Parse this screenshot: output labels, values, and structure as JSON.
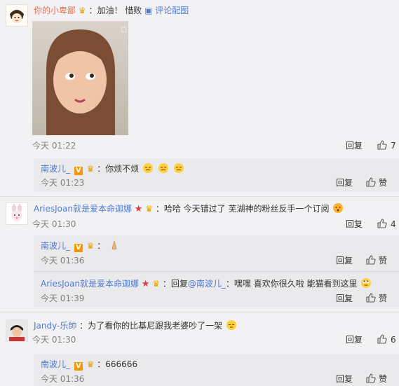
{
  "comments": [
    {
      "user": "你的小卑鄙",
      "text": "：加油！  惜败",
      "link": "评论配图",
      "time": "今天 01:22",
      "reply_label": "回复",
      "likes": "7",
      "replies": [
        {
          "user": "南波儿_",
          "badge": "V",
          "text": "：你烦不烦",
          "time": "今天 01:23",
          "reply_label": "回复",
          "like_label": "赞"
        }
      ]
    },
    {
      "user": "AriesJoan就是爱本命迦娜",
      "text": "：哈哈 今天错过了 芜湖神的粉丝反手一个订阅",
      "time": "今天 01:30",
      "reply_label": "回复",
      "likes": "4",
      "replies": [
        {
          "user": "南波儿_",
          "badge": "V",
          "text": "：",
          "time": "今天 01:36",
          "reply_label": "回复",
          "like_label": "赞"
        },
        {
          "user": "AriesJoan就是爱本命迦娜",
          "prefix": "：回复",
          "mention": "@南波儿_",
          "text": "：嘿嘿 喜欢你很久啦 能猫看到这里",
          "time": "今天 01:39",
          "reply_label": "回复",
          "like_label": "赞"
        }
      ]
    },
    {
      "user": "Jandy-乐帥",
      "text": "：为了看你的比基尼跟我老婆吵了一架",
      "time": "今天 01:30",
      "reply_label": "回复",
      "likes": "6",
      "replies": [
        {
          "user": "南波儿_",
          "badge": "V",
          "text": "：666666",
          "time": "今天 01:36",
          "reply_label": "回复",
          "like_label": "赞"
        }
      ]
    }
  ],
  "icons": {
    "image_link": "image-icon",
    "like": "thumbs-up-icon",
    "reply_emoji": "folded-hands-icon"
  },
  "colors": {
    "username": "#eb7350",
    "badge": "#f39800",
    "background": "#f2f2f5",
    "reply_background": "#eaeaec"
  }
}
